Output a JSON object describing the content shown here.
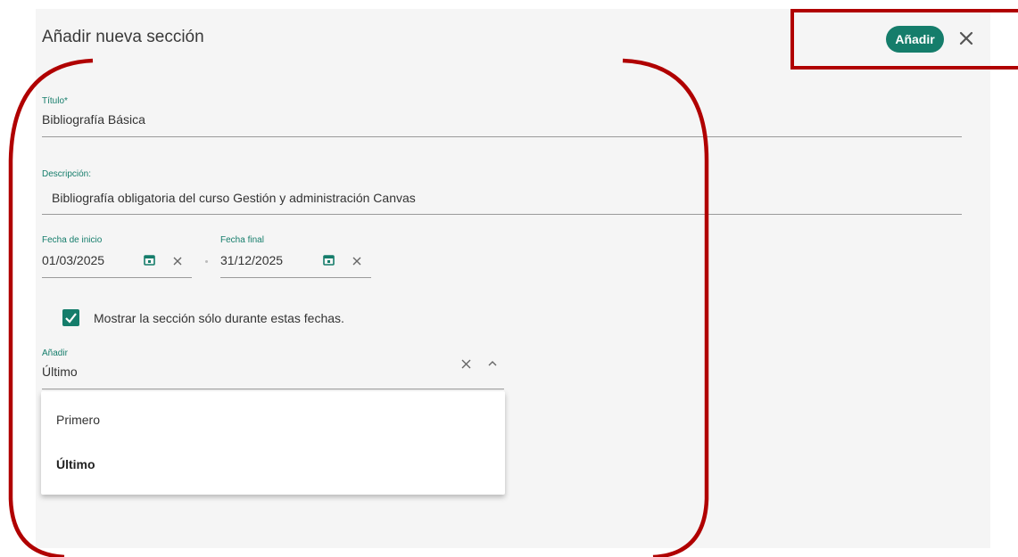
{
  "dialog": {
    "title": "Añadir nueva sección",
    "add_label": "Añadir"
  },
  "form": {
    "title_label": "Título*",
    "title_value": "Bibliografía Básica",
    "description_label": "Descripción:",
    "description_value": "Bibliografía obligatoria del curso Gestión y administración Canvas",
    "start_label": "Fecha de inicio",
    "start_value": "01/03/2025",
    "end_label": "Fecha final",
    "end_value": "31/12/2025",
    "show_only_label": "Mostrar la sección sólo durante estas fechas.",
    "show_only_checked": true,
    "position_label": "Añadir",
    "position_value": "Último",
    "position_options": [
      "Primero",
      "Último"
    ]
  },
  "colors": {
    "accent": "#157d6b",
    "annotation": "#b00000"
  }
}
